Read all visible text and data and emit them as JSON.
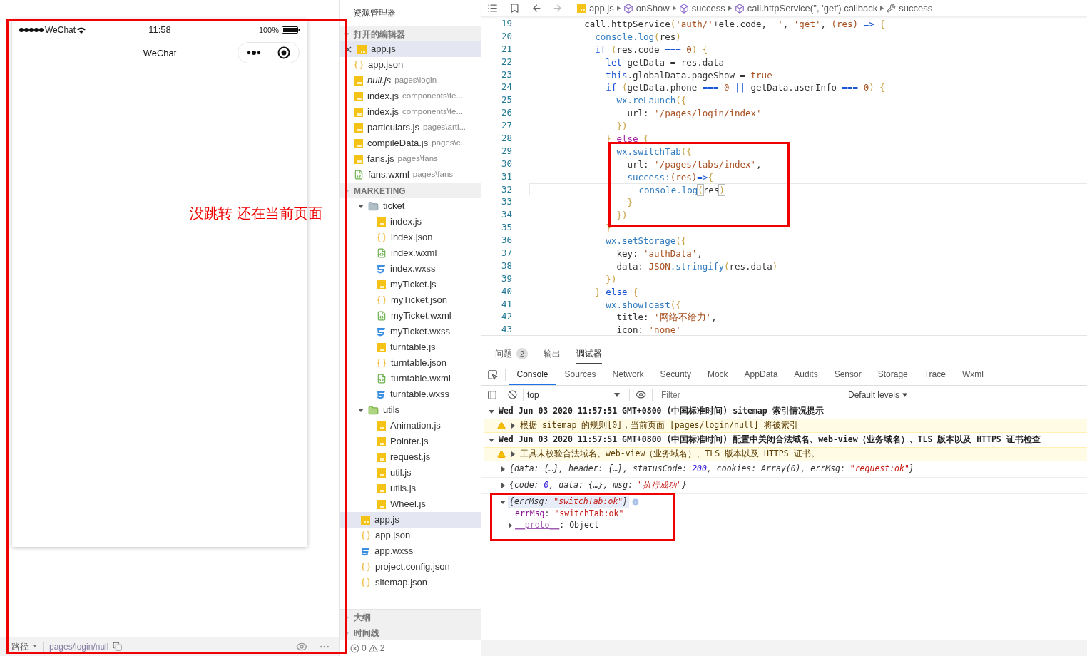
{
  "simulator": {
    "carrier": "WeChat",
    "time": "11:58",
    "battery": "100%",
    "title": "WeChat",
    "path_label": "路径",
    "path": "pages/login/null"
  },
  "annotation": {
    "text": "没跳转 还在当前页面"
  },
  "explorer": {
    "title": "资源管理器",
    "open_editors": {
      "label": "打开的编辑器",
      "expanded": true,
      "items": [
        {
          "name": "app.js",
          "kind": "js",
          "italic": false,
          "selected": true
        },
        {
          "name": "app.json",
          "kind": "json",
          "italic": false,
          "selected": false
        },
        {
          "name": "null.js",
          "path": "pages\\login",
          "kind": "js",
          "italic": true,
          "selected": false
        },
        {
          "name": "index.js",
          "path": "components\\te...",
          "kind": "js",
          "italic": false,
          "selected": false
        },
        {
          "name": "index.js",
          "path": "components\\te...",
          "kind": "js",
          "italic": false,
          "selected": false
        },
        {
          "name": "particulars.js",
          "path": "pages\\arti...",
          "kind": "js",
          "italic": false,
          "selected": false
        },
        {
          "name": "compileData.js",
          "path": "pages\\c...",
          "kind": "js",
          "italic": false,
          "selected": false
        },
        {
          "name": "fans.js",
          "path": "pages\\fans",
          "kind": "js",
          "italic": false,
          "selected": false
        },
        {
          "name": "fans.wxml",
          "path": "pages\\fans",
          "kind": "wxml",
          "italic": false,
          "selected": false
        }
      ]
    },
    "project": {
      "label": "MARKETING",
      "expanded": true,
      "items": [
        {
          "name": "ticket",
          "kind": "folder",
          "expanded": true,
          "selected": false,
          "children": [
            {
              "name": "index.js",
              "kind": "js",
              "selected": false
            },
            {
              "name": "index.json",
              "kind": "json",
              "selected": false
            },
            {
              "name": "index.wxml",
              "kind": "wxml",
              "selected": false
            },
            {
              "name": "index.wxss",
              "kind": "wxss",
              "selected": false
            },
            {
              "name": "myTicket.js",
              "kind": "js",
              "selected": false
            },
            {
              "name": "myTicket.json",
              "kind": "json",
              "selected": false
            },
            {
              "name": "myTicket.wxml",
              "kind": "wxml",
              "selected": false
            },
            {
              "name": "myTicket.wxss",
              "kind": "wxss",
              "selected": false
            },
            {
              "name": "turntable.js",
              "kind": "js",
              "selected": false
            },
            {
              "name": "turntable.json",
              "kind": "json",
              "selected": false
            },
            {
              "name": "turntable.wxml",
              "kind": "wxml",
              "selected": false
            },
            {
              "name": "turntable.wxss",
              "kind": "wxss",
              "selected": false
            }
          ]
        },
        {
          "name": "utils",
          "kind": "libfolder",
          "expanded": true,
          "selected": false,
          "children": [
            {
              "name": "Animation.js",
              "kind": "js",
              "selected": false
            },
            {
              "name": "Pointer.js",
              "kind": "js",
              "selected": false
            },
            {
              "name": "request.js",
              "kind": "js",
              "selected": false
            },
            {
              "name": "util.js",
              "kind": "js",
              "selected": false
            },
            {
              "name": "utils.js",
              "kind": "js",
              "selected": false
            },
            {
              "name": "Wheel.js",
              "kind": "js",
              "selected": false
            }
          ]
        },
        {
          "name": "app.js",
          "kind": "js",
          "selected": true
        },
        {
          "name": "app.json",
          "kind": "json",
          "selected": false
        },
        {
          "name": "app.wxss",
          "kind": "wxss",
          "selected": false
        },
        {
          "name": "project.config.json",
          "kind": "json",
          "selected": false
        },
        {
          "name": "sitemap.json",
          "kind": "json",
          "selected": false
        }
      ]
    },
    "outline": {
      "label": "大纲",
      "expanded": false
    },
    "timeline": {
      "label": "时间线",
      "expanded": false
    },
    "status": {
      "errors": "0",
      "warnings": "2"
    }
  },
  "editor": {
    "breadcrumb": [
      {
        "label": "app.js",
        "kind": "js"
      },
      {
        "label": "onShow",
        "kind": "method"
      },
      {
        "label": "success",
        "kind": "method"
      },
      {
        "label": "call.httpService('', 'get') callback",
        "kind": "method"
      },
      {
        "label": "success",
        "kind": "property"
      }
    ],
    "lines": [
      {
        "no": "19",
        "current": false,
        "tokens": [
          {
            "t": "          call.httpService",
            "kind": "p"
          },
          {
            "t": "(",
            "kind": "b"
          },
          {
            "t": "'auth/'",
            "kind": "s"
          },
          {
            "t": "+ele.code, ",
            "kind": "p"
          },
          {
            "t": "''",
            "kind": "s"
          },
          {
            "t": ", ",
            "kind": "p"
          },
          {
            "t": "'get'",
            "kind": "s"
          },
          {
            "t": ", ",
            "kind": "p"
          },
          {
            "t": "(res) ",
            "kind": "s"
          },
          {
            "t": "=>",
            "kind": "k"
          },
          {
            "t": " {",
            "kind": "b"
          }
        ]
      },
      {
        "no": "20",
        "current": false,
        "tokens": [
          {
            "t": "            console.log",
            "kind": "f"
          },
          {
            "t": "(",
            "kind": "b"
          },
          {
            "t": "res",
            "kind": "p"
          },
          {
            "t": ")",
            "kind": "b"
          }
        ]
      },
      {
        "no": "21",
        "current": false,
        "tokens": [
          {
            "t": "            if",
            "kind": "k"
          },
          {
            "t": " (",
            "kind": "b"
          },
          {
            "t": "res.code ",
            "kind": "p"
          },
          {
            "t": "===",
            "kind": "k"
          },
          {
            "t": " 0",
            "kind": "s"
          },
          {
            "t": ") {",
            "kind": "b"
          }
        ]
      },
      {
        "no": "22",
        "current": false,
        "tokens": [
          {
            "t": "              let",
            "kind": "k"
          },
          {
            "t": " getData = res.data",
            "kind": "p"
          }
        ]
      },
      {
        "no": "23",
        "current": false,
        "tokens": [
          {
            "t": "              this",
            "kind": "k"
          },
          {
            "t": ".globalData.pageShow = ",
            "kind": "p"
          },
          {
            "t": "true",
            "kind": "s"
          }
        ]
      },
      {
        "no": "24",
        "current": false,
        "tokens": [
          {
            "t": "              if",
            "kind": "k"
          },
          {
            "t": " (",
            "kind": "b"
          },
          {
            "t": "getData.phone ",
            "kind": "p"
          },
          {
            "t": "===",
            "kind": "k"
          },
          {
            "t": " 0 ",
            "kind": "s"
          },
          {
            "t": "||",
            "kind": "k"
          },
          {
            "t": " getData.userInfo ",
            "kind": "p"
          },
          {
            "t": "===",
            "kind": "k"
          },
          {
            "t": " 0",
            "kind": "s"
          },
          {
            "t": ") {",
            "kind": "b"
          }
        ]
      },
      {
        "no": "25",
        "current": false,
        "tokens": [
          {
            "t": "                wx.reLaunch",
            "kind": "f"
          },
          {
            "t": "({",
            "kind": "b"
          }
        ]
      },
      {
        "no": "26",
        "current": false,
        "tokens": [
          {
            "t": "                  url: ",
            "kind": "p"
          },
          {
            "t": "'/pages/login/index'",
            "kind": "s"
          }
        ]
      },
      {
        "no": "27",
        "current": false,
        "tokens": [
          {
            "t": "                })",
            "kind": "b"
          }
        ]
      },
      {
        "no": "28",
        "current": false,
        "tokens": [
          {
            "t": "              } ",
            "kind": "b"
          },
          {
            "t": "else",
            "kind": "c"
          },
          {
            "t": " {",
            "kind": "b"
          }
        ]
      },
      {
        "no": "29",
        "current": false,
        "tokens": [
          {
            "t": "                wx.switchTab",
            "kind": "f"
          },
          {
            "t": "({",
            "kind": "b"
          }
        ]
      },
      {
        "no": "30",
        "current": false,
        "tokens": [
          {
            "t": "                  url: ",
            "kind": "p"
          },
          {
            "t": "'/pages/tabs/index'",
            "kind": "s"
          },
          {
            "t": ",",
            "kind": "p"
          }
        ]
      },
      {
        "no": "31",
        "current": false,
        "tokens": [
          {
            "t": "                  success:",
            "kind": "f"
          },
          {
            "t": "(res)",
            "kind": "s"
          },
          {
            "t": "=>",
            "kind": "k"
          },
          {
            "t": "{",
            "kind": "b"
          }
        ]
      },
      {
        "no": "32",
        "current": true,
        "tokens": [
          {
            "t": "                    console.log",
            "kind": "f"
          },
          {
            "t": "(",
            "kind": "m"
          },
          {
            "t": "res",
            "kind": "p"
          },
          {
            "t": ")",
            "kind": "m"
          }
        ]
      },
      {
        "no": "33",
        "current": false,
        "tokens": [
          {
            "t": "                  }",
            "kind": "b"
          }
        ]
      },
      {
        "no": "34",
        "current": false,
        "tokens": [
          {
            "t": "                })",
            "kind": "b"
          }
        ]
      },
      {
        "no": "35",
        "current": false,
        "tokens": [
          {
            "t": "              }",
            "kind": "b"
          }
        ]
      },
      {
        "no": "36",
        "current": false,
        "tokens": [
          {
            "t": "              wx.setStorage",
            "kind": "f"
          },
          {
            "t": "({",
            "kind": "b"
          }
        ]
      },
      {
        "no": "37",
        "current": false,
        "tokens": [
          {
            "t": "                key: ",
            "kind": "p"
          },
          {
            "t": "'authData'",
            "kind": "s"
          },
          {
            "t": ",",
            "kind": "p"
          }
        ]
      },
      {
        "no": "38",
        "current": false,
        "tokens": [
          {
            "t": "                data: ",
            "kind": "p"
          },
          {
            "t": "JSON",
            "kind": "s"
          },
          {
            "t": ".stringify",
            "kind": "f"
          },
          {
            "t": "(",
            "kind": "b"
          },
          {
            "t": "res.data",
            "kind": "p"
          },
          {
            "t": ")",
            "kind": "b"
          }
        ]
      },
      {
        "no": "39",
        "current": false,
        "tokens": [
          {
            "t": "              })",
            "kind": "b"
          }
        ]
      },
      {
        "no": "40",
        "current": false,
        "tokens": [
          {
            "t": "            } ",
            "kind": "b"
          },
          {
            "t": "else",
            "kind": "k"
          },
          {
            "t": " {",
            "kind": "b"
          }
        ]
      },
      {
        "no": "41",
        "current": false,
        "tokens": [
          {
            "t": "              wx.showToast",
            "kind": "f"
          },
          {
            "t": "({",
            "kind": "b"
          }
        ]
      },
      {
        "no": "42",
        "current": false,
        "tokens": [
          {
            "t": "                title: ",
            "kind": "p"
          },
          {
            "t": "'网络不给力'",
            "kind": "s"
          },
          {
            "t": ",",
            "kind": "p"
          }
        ]
      },
      {
        "no": "43",
        "current": false,
        "tokens": [
          {
            "t": "                icon: ",
            "kind": "p"
          },
          {
            "t": "'none'",
            "kind": "s"
          }
        ]
      }
    ]
  },
  "devtools": {
    "panel_tabs": [
      {
        "label": "问题",
        "badge": "2",
        "selected": false
      },
      {
        "label": "输出",
        "selected": false
      },
      {
        "label": "调试器",
        "selected": true
      }
    ],
    "tool_tabs": [
      {
        "label": "Console",
        "selected": true
      },
      {
        "label": "Sources",
        "selected": false
      },
      {
        "label": "Network",
        "selected": false
      },
      {
        "label": "Security",
        "selected": false
      },
      {
        "label": "Mock",
        "selected": false
      },
      {
        "label": "AppData",
        "selected": false
      },
      {
        "label": "Audits",
        "selected": false
      },
      {
        "label": "Sensor",
        "selected": false
      },
      {
        "label": "Storage",
        "selected": false
      },
      {
        "label": "Trace",
        "selected": false
      },
      {
        "label": "Wxml",
        "selected": false
      }
    ],
    "context": "top",
    "filter_placeholder": "Filter",
    "levels": "Default levels",
    "rows": [
      {
        "kind": "group",
        "expanded": true,
        "text": "Wed Jun 03 2020 11:57:51 GMT+0800 (中国标准时间) sitemap 索引情况提示"
      },
      {
        "kind": "warning",
        "expanded": false,
        "text": "根据 sitemap 的规则[0]，当前页面 [pages/login/null] 将被索引"
      },
      {
        "kind": "group",
        "expanded": true,
        "text": "Wed Jun 03 2020 11:57:51 GMT+0800 (中国标准时间) 配置中关闭合法域名、web-view（业务域名）、TLS 版本以及 HTTPS 证书检查"
      },
      {
        "kind": "warning",
        "expanded": false,
        "text": "工具未校验合法域名、web-view（业务域名）、TLS 版本以及 HTTPS 证书。"
      },
      {
        "kind": "object",
        "expanded": false,
        "tokens": [
          {
            "t": "{data: {…}, header: {…}, statusCode: ",
            "kind": "p"
          },
          {
            "t": "200",
            "kind": "n"
          },
          {
            "t": ", cookies: Array(0), errMsg: ",
            "kind": "p"
          },
          {
            "t": "\"request:ok\"",
            "kind": "s"
          },
          {
            "t": "}",
            "kind": "p"
          }
        ]
      },
      {
        "kind": "object",
        "expanded": false,
        "tokens": [
          {
            "t": "{code: ",
            "kind": "p"
          },
          {
            "t": "0",
            "kind": "n"
          },
          {
            "t": ", data: {…}, msg: ",
            "kind": "p"
          },
          {
            "t": "\"执行成功\"",
            "kind": "s"
          },
          {
            "t": "}",
            "kind": "p"
          }
        ]
      },
      {
        "kind": "object",
        "expanded": true,
        "tokens": [
          {
            "t": "{errMsg: ",
            "kind": "p"
          },
          {
            "t": "\"switchTab:ok\"",
            "kind": "s"
          },
          {
            "t": "}",
            "kind": "p"
          }
        ],
        "children": [
          {
            "expandable": false,
            "tokens": [
              {
                "t": "errMsg",
                "kind": "key"
              },
              {
                "t": ": ",
                "kind": "p"
              },
              {
                "t": "\"switchTab:ok\"",
                "kind": "s"
              }
            ]
          },
          {
            "expandable": true,
            "tokens": [
              {
                "t": "__proto__",
                "kind": "proto"
              },
              {
                "t": ": Object",
                "kind": "p"
              }
            ]
          }
        ]
      }
    ]
  }
}
